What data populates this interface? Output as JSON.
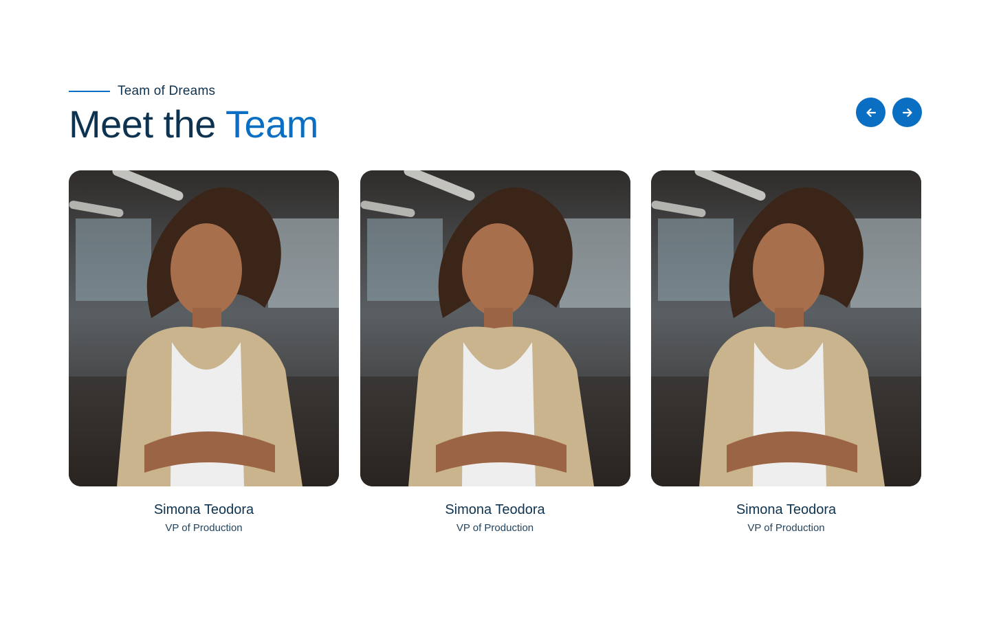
{
  "header": {
    "eyebrow": "Team of Dreams",
    "title_plain": "Meet the",
    "title_accent": "Team"
  },
  "nav": {
    "prev_icon": "arrow-left-icon",
    "next_icon": "arrow-right-icon"
  },
  "colors": {
    "accent": "#0a6fc2",
    "heading": "#0e3350",
    "background": "#ffffff"
  },
  "team": [
    {
      "name": "Simona Teodora",
      "role": "VP of Production"
    },
    {
      "name": "Simona Teodora",
      "role": "VP of Production"
    },
    {
      "name": "Simona Teodora",
      "role": "VP of Production"
    }
  ]
}
